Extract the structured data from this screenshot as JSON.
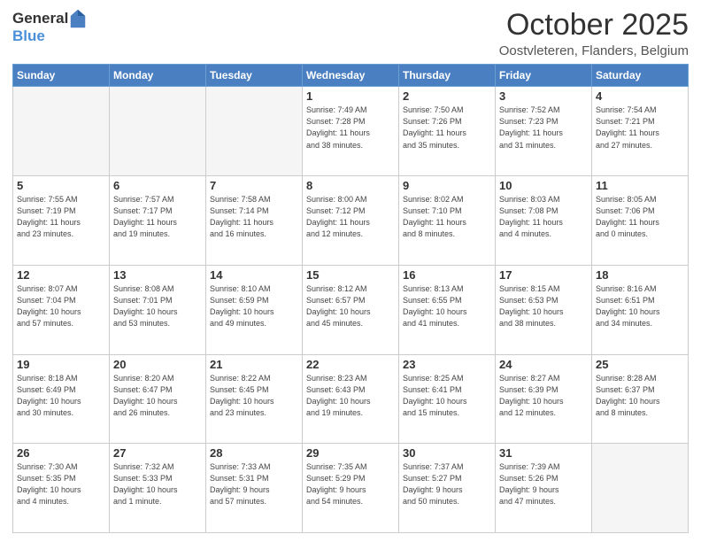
{
  "logo": {
    "general": "General",
    "blue": "Blue"
  },
  "title": "October 2025",
  "location": "Oostvleteren, Flanders, Belgium",
  "days_of_week": [
    "Sunday",
    "Monday",
    "Tuesday",
    "Wednesday",
    "Thursday",
    "Friday",
    "Saturday"
  ],
  "weeks": [
    [
      {
        "day": "",
        "info": ""
      },
      {
        "day": "",
        "info": ""
      },
      {
        "day": "",
        "info": ""
      },
      {
        "day": "1",
        "info": "Sunrise: 7:49 AM\nSunset: 7:28 PM\nDaylight: 11 hours\nand 38 minutes."
      },
      {
        "day": "2",
        "info": "Sunrise: 7:50 AM\nSunset: 7:26 PM\nDaylight: 11 hours\nand 35 minutes."
      },
      {
        "day": "3",
        "info": "Sunrise: 7:52 AM\nSunset: 7:23 PM\nDaylight: 11 hours\nand 31 minutes."
      },
      {
        "day": "4",
        "info": "Sunrise: 7:54 AM\nSunset: 7:21 PM\nDaylight: 11 hours\nand 27 minutes."
      }
    ],
    [
      {
        "day": "5",
        "info": "Sunrise: 7:55 AM\nSunset: 7:19 PM\nDaylight: 11 hours\nand 23 minutes."
      },
      {
        "day": "6",
        "info": "Sunrise: 7:57 AM\nSunset: 7:17 PM\nDaylight: 11 hours\nand 19 minutes."
      },
      {
        "day": "7",
        "info": "Sunrise: 7:58 AM\nSunset: 7:14 PM\nDaylight: 11 hours\nand 16 minutes."
      },
      {
        "day": "8",
        "info": "Sunrise: 8:00 AM\nSunset: 7:12 PM\nDaylight: 11 hours\nand 12 minutes."
      },
      {
        "day": "9",
        "info": "Sunrise: 8:02 AM\nSunset: 7:10 PM\nDaylight: 11 hours\nand 8 minutes."
      },
      {
        "day": "10",
        "info": "Sunrise: 8:03 AM\nSunset: 7:08 PM\nDaylight: 11 hours\nand 4 minutes."
      },
      {
        "day": "11",
        "info": "Sunrise: 8:05 AM\nSunset: 7:06 PM\nDaylight: 11 hours\nand 0 minutes."
      }
    ],
    [
      {
        "day": "12",
        "info": "Sunrise: 8:07 AM\nSunset: 7:04 PM\nDaylight: 10 hours\nand 57 minutes."
      },
      {
        "day": "13",
        "info": "Sunrise: 8:08 AM\nSunset: 7:01 PM\nDaylight: 10 hours\nand 53 minutes."
      },
      {
        "day": "14",
        "info": "Sunrise: 8:10 AM\nSunset: 6:59 PM\nDaylight: 10 hours\nand 49 minutes."
      },
      {
        "day": "15",
        "info": "Sunrise: 8:12 AM\nSunset: 6:57 PM\nDaylight: 10 hours\nand 45 minutes."
      },
      {
        "day": "16",
        "info": "Sunrise: 8:13 AM\nSunset: 6:55 PM\nDaylight: 10 hours\nand 41 minutes."
      },
      {
        "day": "17",
        "info": "Sunrise: 8:15 AM\nSunset: 6:53 PM\nDaylight: 10 hours\nand 38 minutes."
      },
      {
        "day": "18",
        "info": "Sunrise: 8:16 AM\nSunset: 6:51 PM\nDaylight: 10 hours\nand 34 minutes."
      }
    ],
    [
      {
        "day": "19",
        "info": "Sunrise: 8:18 AM\nSunset: 6:49 PM\nDaylight: 10 hours\nand 30 minutes."
      },
      {
        "day": "20",
        "info": "Sunrise: 8:20 AM\nSunset: 6:47 PM\nDaylight: 10 hours\nand 26 minutes."
      },
      {
        "day": "21",
        "info": "Sunrise: 8:22 AM\nSunset: 6:45 PM\nDaylight: 10 hours\nand 23 minutes."
      },
      {
        "day": "22",
        "info": "Sunrise: 8:23 AM\nSunset: 6:43 PM\nDaylight: 10 hours\nand 19 minutes."
      },
      {
        "day": "23",
        "info": "Sunrise: 8:25 AM\nSunset: 6:41 PM\nDaylight: 10 hours\nand 15 minutes."
      },
      {
        "day": "24",
        "info": "Sunrise: 8:27 AM\nSunset: 6:39 PM\nDaylight: 10 hours\nand 12 minutes."
      },
      {
        "day": "25",
        "info": "Sunrise: 8:28 AM\nSunset: 6:37 PM\nDaylight: 10 hours\nand 8 minutes."
      }
    ],
    [
      {
        "day": "26",
        "info": "Sunrise: 7:30 AM\nSunset: 5:35 PM\nDaylight: 10 hours\nand 4 minutes."
      },
      {
        "day": "27",
        "info": "Sunrise: 7:32 AM\nSunset: 5:33 PM\nDaylight: 10 hours\nand 1 minute."
      },
      {
        "day": "28",
        "info": "Sunrise: 7:33 AM\nSunset: 5:31 PM\nDaylight: 9 hours\nand 57 minutes."
      },
      {
        "day": "29",
        "info": "Sunrise: 7:35 AM\nSunset: 5:29 PM\nDaylight: 9 hours\nand 54 minutes."
      },
      {
        "day": "30",
        "info": "Sunrise: 7:37 AM\nSunset: 5:27 PM\nDaylight: 9 hours\nand 50 minutes."
      },
      {
        "day": "31",
        "info": "Sunrise: 7:39 AM\nSunset: 5:26 PM\nDaylight: 9 hours\nand 47 minutes."
      },
      {
        "day": "",
        "info": ""
      }
    ]
  ]
}
